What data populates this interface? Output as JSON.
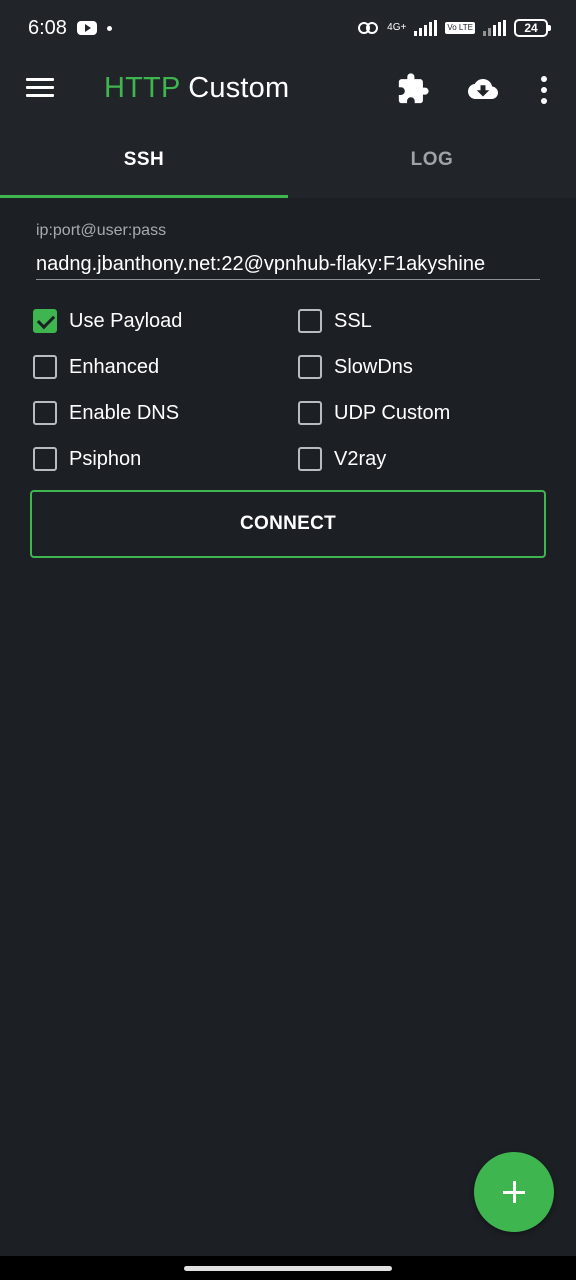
{
  "status_bar": {
    "time": "6:08",
    "net1": "4G+",
    "net2": "Vo LTE",
    "battery": "24",
    "icons": [
      "youtube-icon",
      "dot-icon",
      "hotspot-link-icon",
      "signal-icon",
      "battery-icon"
    ]
  },
  "app_bar": {
    "title_brand": "HTTP",
    "title_rest": " Custom",
    "icons": [
      "menu-icon",
      "puzzle-icon",
      "cloud-download-icon",
      "more-vert-icon"
    ]
  },
  "tabs": [
    {
      "label": "SSH",
      "active": true
    },
    {
      "label": "LOG",
      "active": false
    }
  ],
  "ssh": {
    "field_label": "ip:port@user:pass",
    "field_value": "nadng.jbanthony.net:22@vpnhub-flaky:F1akyshine"
  },
  "options": [
    {
      "label": "Use Payload",
      "checked": true
    },
    {
      "label": "SSL",
      "checked": false
    },
    {
      "label": "Enhanced",
      "checked": false
    },
    {
      "label": "SlowDns",
      "checked": false
    },
    {
      "label": "Enable DNS",
      "checked": false
    },
    {
      "label": "UDP Custom",
      "checked": false
    },
    {
      "label": "Psiphon",
      "checked": false
    },
    {
      "label": "V2ray",
      "checked": false
    }
  ],
  "connect_label": "CONNECT",
  "colors": {
    "accent": "#3fb550",
    "background": "#1c1f24",
    "app_bar": "#212429"
  }
}
